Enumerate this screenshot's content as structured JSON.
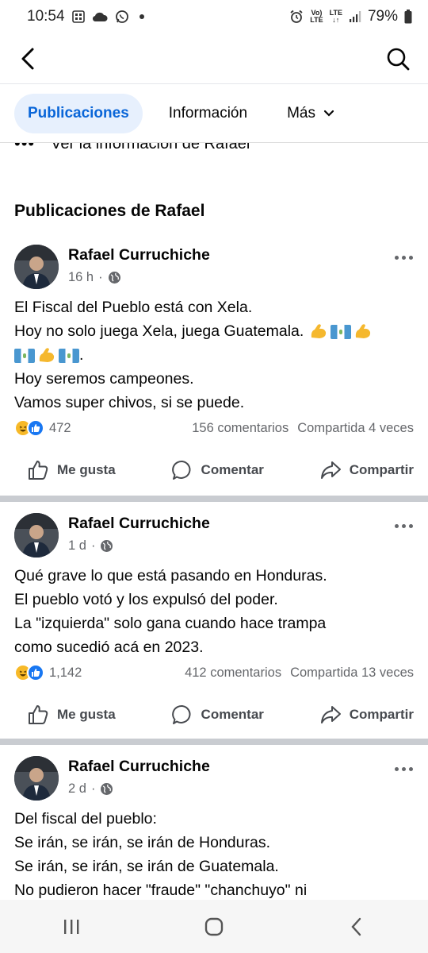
{
  "status_bar": {
    "time": "10:54",
    "battery": "79%",
    "icons": [
      "gallery-icon",
      "cloud-icon",
      "whatsapp-icon",
      "dot-icon",
      "alarm-icon",
      "volte-icon",
      "lte-icon",
      "signal-icon",
      "battery-icon"
    ],
    "volte_top": "Vo)",
    "volte_bottom": "LTE",
    "lte_label": "LTE"
  },
  "header": {
    "back_icon": "back-arrow-icon",
    "search_icon": "search-icon"
  },
  "tabs": [
    {
      "label": "Publicaciones",
      "active": true
    },
    {
      "label": "Información",
      "active": false
    },
    {
      "label": "Más",
      "active": false
    }
  ],
  "cut_row": {
    "text": "Ver la información de Rafael"
  },
  "section_title": "Publicaciones de Rafael",
  "posts": [
    {
      "author": "Rafael Curruchiche",
      "time": "16 h",
      "privacy_icon": "globe-icon",
      "lines": [
        "El Fiscal del Pueblo está con Xela.",
        "Hoy no solo juega Xela, juega Guatemala."
      ],
      "emoji_line_end": ".",
      "lines_after": [
        "Hoy seremos campeones.",
        "Vamos super chivos, si se puede."
      ],
      "reactions_count": "472",
      "comments": "156 comentarios",
      "shares": "Compartida 4 veces"
    },
    {
      "author": "Rafael Curruchiche",
      "time": "1 d",
      "privacy_icon": "globe-icon",
      "lines": [
        "Qué grave lo que está pasando en Honduras.",
        "El pueblo votó y los expulsó del poder.",
        "La \"izquierda\" solo gana cuando hace trampa",
        "como sucedió acá en 2023."
      ],
      "reactions_count": "1,142",
      "comments": "412 comentarios",
      "shares": "Compartida 13 veces"
    },
    {
      "author": "Rafael Curruchiche",
      "time": "2 d",
      "privacy_icon": "globe-icon",
      "lines": [
        "Del fiscal del pueblo:",
        "Se irán, se irán, se irán de Honduras.",
        "Se irán, se irán, se irán de Guatemala.",
        "No pudieron hacer \"fraude\" \"chanchuyo\" ni"
      ]
    }
  ],
  "actions": {
    "like": "Me gusta",
    "comment": "Comentar",
    "share": "Compartir"
  },
  "nav_bar": {
    "icons": [
      "recents-icon",
      "home-icon",
      "back-icon"
    ]
  },
  "colors": {
    "accent": "#0a66d8",
    "tab_active_bg": "#e7f0fd",
    "secondary_text": "#65676b",
    "divider": "#c9ccd1",
    "like_blue": "#1877f2",
    "haha_yellow": "#f7b928"
  }
}
